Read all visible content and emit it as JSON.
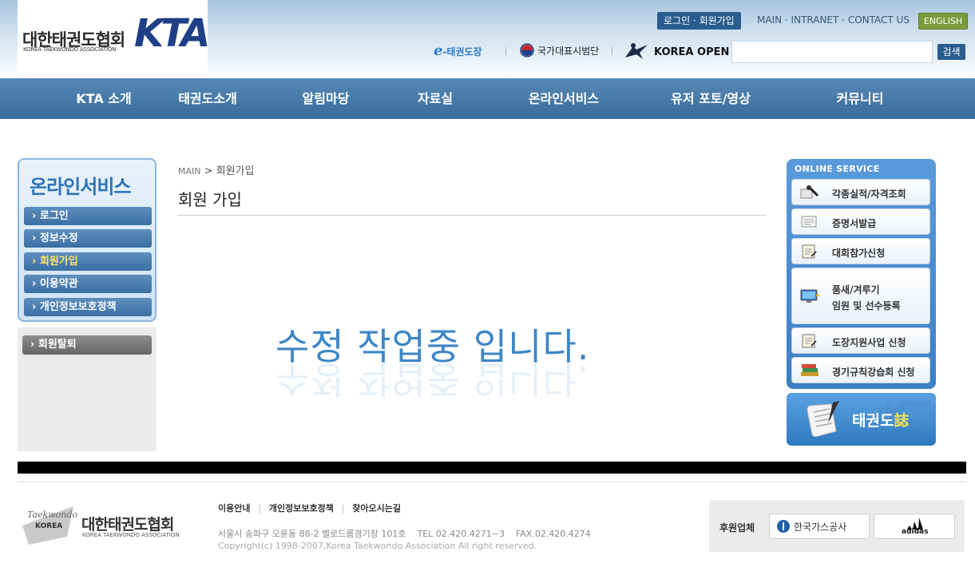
{
  "header": {
    "logo_ko": "대한태권도협회",
    "logo_en": "KOREA TAEKWONDO ASSOCIATION",
    "logo_mark": "KTA",
    "login_join": "로그인 · 회원가입",
    "top_links": [
      "MAIN",
      "INTRANET",
      "CONTACT US"
    ],
    "english": "ENGLISH",
    "sub_links": {
      "e_prefix": "e",
      "e_tkd": "-태권도장",
      "national_team": "국가대표시범단",
      "korea_open": "KOREA OPEN"
    },
    "search_placeholder": "",
    "search_button": "검색"
  },
  "nav": [
    "KTA 소개",
    "태권도소개",
    "알림마당",
    "자료실",
    "온라인서비스",
    "유저 포토/영상",
    "커뮤니티"
  ],
  "left_sidebar": {
    "title": "온라인서비스",
    "items": [
      "› 로그인",
      "› 정보수정",
      "› 회원가입",
      "› 이용약관",
      "› 개인정보보호정책"
    ],
    "active_index": 2,
    "withdraw": "› 회원탈퇴"
  },
  "main": {
    "breadcrumb_home": "MAIN",
    "breadcrumb_sep": " > ",
    "breadcrumb_current": "회원가입",
    "title": "회원 가입",
    "wip_message": "수정 작업중 입니다."
  },
  "right_sidebar": {
    "title": "ONLINE SERVICE",
    "items": [
      {
        "label": "각종실적/자격조회",
        "icon": "search-record-icon"
      },
      {
        "label": "증명서발급",
        "icon": "certificate-icon"
      },
      {
        "label": "대회참가신청",
        "icon": "clipboard-icon"
      },
      {
        "label_line1": "품새/겨루기",
        "label_line2": "임원 및 선수등록",
        "icon": "monitor-icon"
      },
      {
        "label": "도장지원사업 신청",
        "icon": "clipboard-icon"
      },
      {
        "label": "경기규칙강습회 신청",
        "icon": "books-icon"
      }
    ],
    "magazine_label": "태권도",
    "magazine_accent": "誌",
    "magazine_bg": "KTA"
  },
  "footer": {
    "logo_ko": "대한태권도협회",
    "logo_en": "KOREA TAEKWONDO ASSOCIATION",
    "logo_script": "Taekwondo",
    "logo_korea": "KOREA",
    "links": [
      "이용안내",
      "개인정보보호정책",
      "찾아오시는길"
    ],
    "address": "서울시 송파구 오륜동 88-2 벨로드롬경기장 101호    TEL 02.420.4271~3    FAX.02.420.4274",
    "copyright": "Copyright(c) 1998-2007,Korea Taekwondo Association All right reserved.",
    "sponsor_label": "후원업체",
    "sponsors": [
      "한국가스공사",
      "adidas"
    ]
  }
}
